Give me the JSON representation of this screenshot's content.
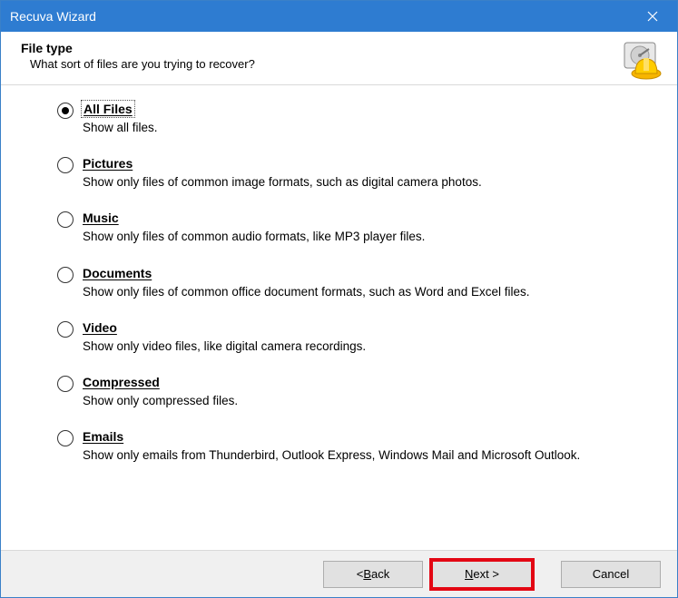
{
  "window": {
    "title": "Recuva Wizard"
  },
  "header": {
    "title": "File type",
    "subtitle": "What sort of files are you trying to recover?"
  },
  "options": {
    "all": {
      "label": "All Files",
      "desc": "Show all files.",
      "checked": true
    },
    "pictures": {
      "label": "Pictures",
      "desc": "Show only files of common image formats, such as digital camera photos."
    },
    "music": {
      "label": "Music",
      "desc": "Show only files of common audio formats, like MP3 player files."
    },
    "documents": {
      "label": "Documents",
      "desc": "Show only files of common office document formats, such as Word and Excel files."
    },
    "video": {
      "label": "Video",
      "desc": "Show only video files, like digital camera recordings."
    },
    "compressed": {
      "label": "Compressed",
      "desc": "Show only compressed files."
    },
    "emails": {
      "label": "Emails",
      "desc": "Show only emails from Thunderbird, Outlook Express, Windows Mail and Microsoft Outlook."
    }
  },
  "footer": {
    "back": "< Back",
    "next": "Next >",
    "cancel": "Cancel"
  }
}
